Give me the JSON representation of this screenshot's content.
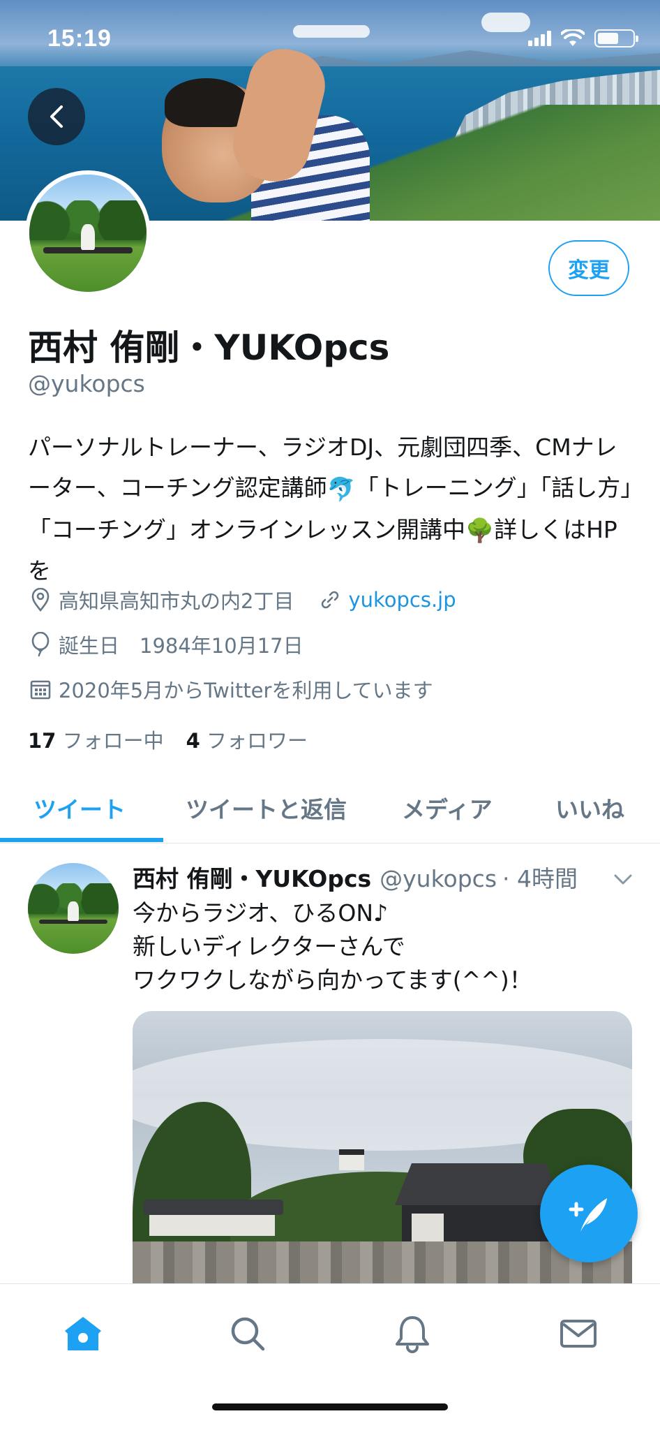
{
  "status_bar": {
    "time": "15:19"
  },
  "colors": {
    "accent": "#1da1f2",
    "text": "#14171a",
    "secondary": "#657786",
    "link": "#1b95e0"
  },
  "icons": {
    "back": "chevron-left-icon",
    "location": "location-pin-icon",
    "link": "link-icon",
    "birthday": "balloon-icon",
    "joined": "calendar-icon",
    "compose": "compose-tweet-icon"
  },
  "profile": {
    "edit_label": "変更",
    "name": "西村 侑剛・YUKOpcs",
    "handle": "@yukopcs",
    "bio_part1": "パーソナルトレーナー、ラジオDJ、元劇団四季、CMナレーター、コーチング認定講師",
    "bio_emoji1": "🐬",
    "bio_part2": "「トレーニング」「話し方」「コーチング」オンラインレッスン開講中",
    "bio_emoji2": "🌳",
    "bio_part3": "詳しくはHPを",
    "location": "高知県高知市丸の内2丁目",
    "website": "yukopcs.jp",
    "birthday": "誕生日　1984年10月17日",
    "joined": "2020年5月からTwitterを利用しています",
    "following_count": "17",
    "following_label": "フォロー中",
    "followers_count": "4",
    "followers_label": "フォロワー"
  },
  "tabs": [
    {
      "label": "ツイート",
      "active": true
    },
    {
      "label": "ツイートと返信",
      "active": false
    },
    {
      "label": "メディア",
      "active": false
    },
    {
      "label": "いいね",
      "active": false
    }
  ],
  "tweet": {
    "name": "西村 侑剛・YUKOpcs",
    "handle": "@yukopcs",
    "time": "· 4時間",
    "text": "今からラジオ、ひるON♪\n新しいディレクターさんで\nワクワクしながら向かってます(^^)！"
  },
  "bottom_nav": [
    {
      "name": "home-icon",
      "active": true
    },
    {
      "name": "search-icon",
      "active": false
    },
    {
      "name": "notifications-icon",
      "active": false
    },
    {
      "name": "messages-icon",
      "active": false
    }
  ]
}
